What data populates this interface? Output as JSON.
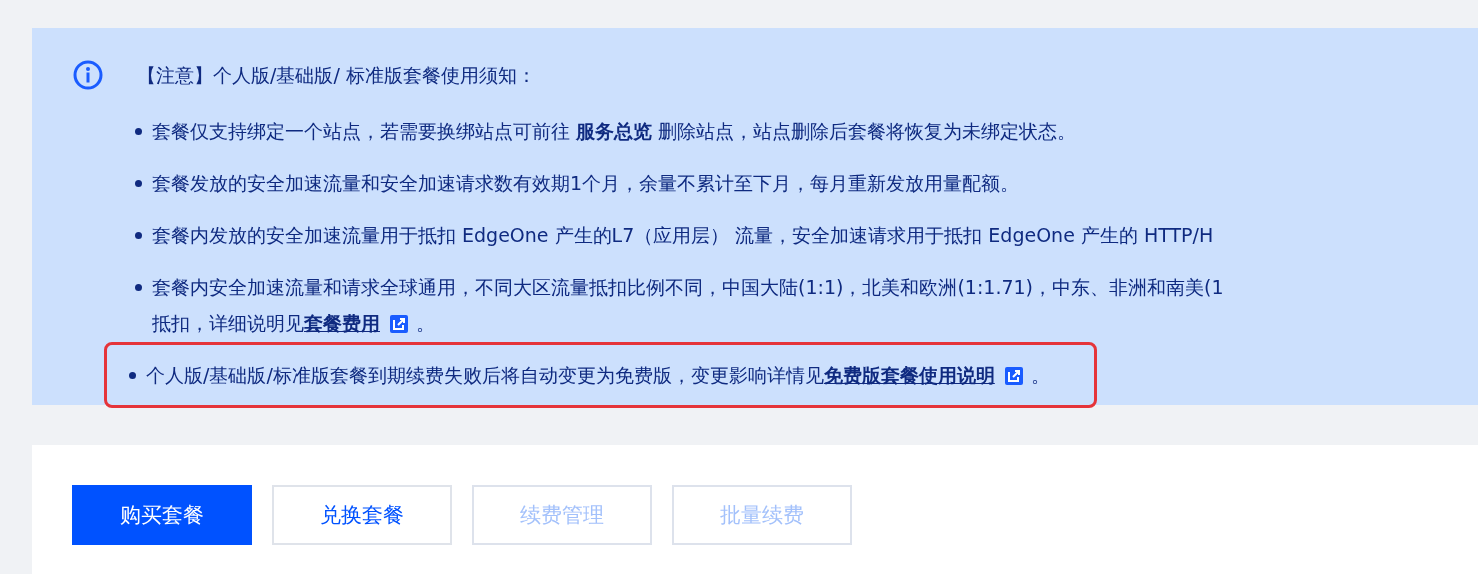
{
  "notice": {
    "title": "【注意】个人版/基础版/ 标准版套餐使用须知：",
    "items": [
      {
        "text": "套餐仅支持绑定一个站点，若需要换绑站点可前往 **服务总览** 删除站点，站点删除后套餐将恢复为未绑定状态。",
        "highlighted": false
      },
      {
        "text": "套餐发放的安全加速流量和安全加速请求数有效期1个月，余量不累计至下月，每月重新发放用量配额。",
        "highlighted": false
      },
      {
        "text": "套餐内发放的安全加速流量用于抵扣 EdgeOne 产生的L7（应用层） 流量，安全加速请求用于抵扣 EdgeOne 产生的 HTTP/H",
        "highlighted": false
      },
      {
        "text": "套餐内安全加速流量和请求全球通用，不同大区流量抵扣比例不同，中国大陆(1:1)，北美和欧洲(1:1.71)，中东、非洲和南美(1",
        "continuation": "抵扣，详细说明见",
        "link": "套餐费用",
        "after": "。",
        "highlighted": false
      },
      {
        "text": "个人版/基础版/标准版套餐到期续费失败后将自动变更为免费版，变更影响详情见",
        "link": "免费版套餐使用说明",
        "after": "。",
        "highlighted": true
      }
    ]
  },
  "buttons": [
    {
      "label": "购买套餐",
      "kind": "primary",
      "disabled": false
    },
    {
      "label": "兑换套餐",
      "kind": "default",
      "disabled": false
    },
    {
      "label": "续费管理",
      "kind": "default",
      "disabled": true
    },
    {
      "label": "批量续费",
      "kind": "default",
      "disabled": true
    }
  ]
}
